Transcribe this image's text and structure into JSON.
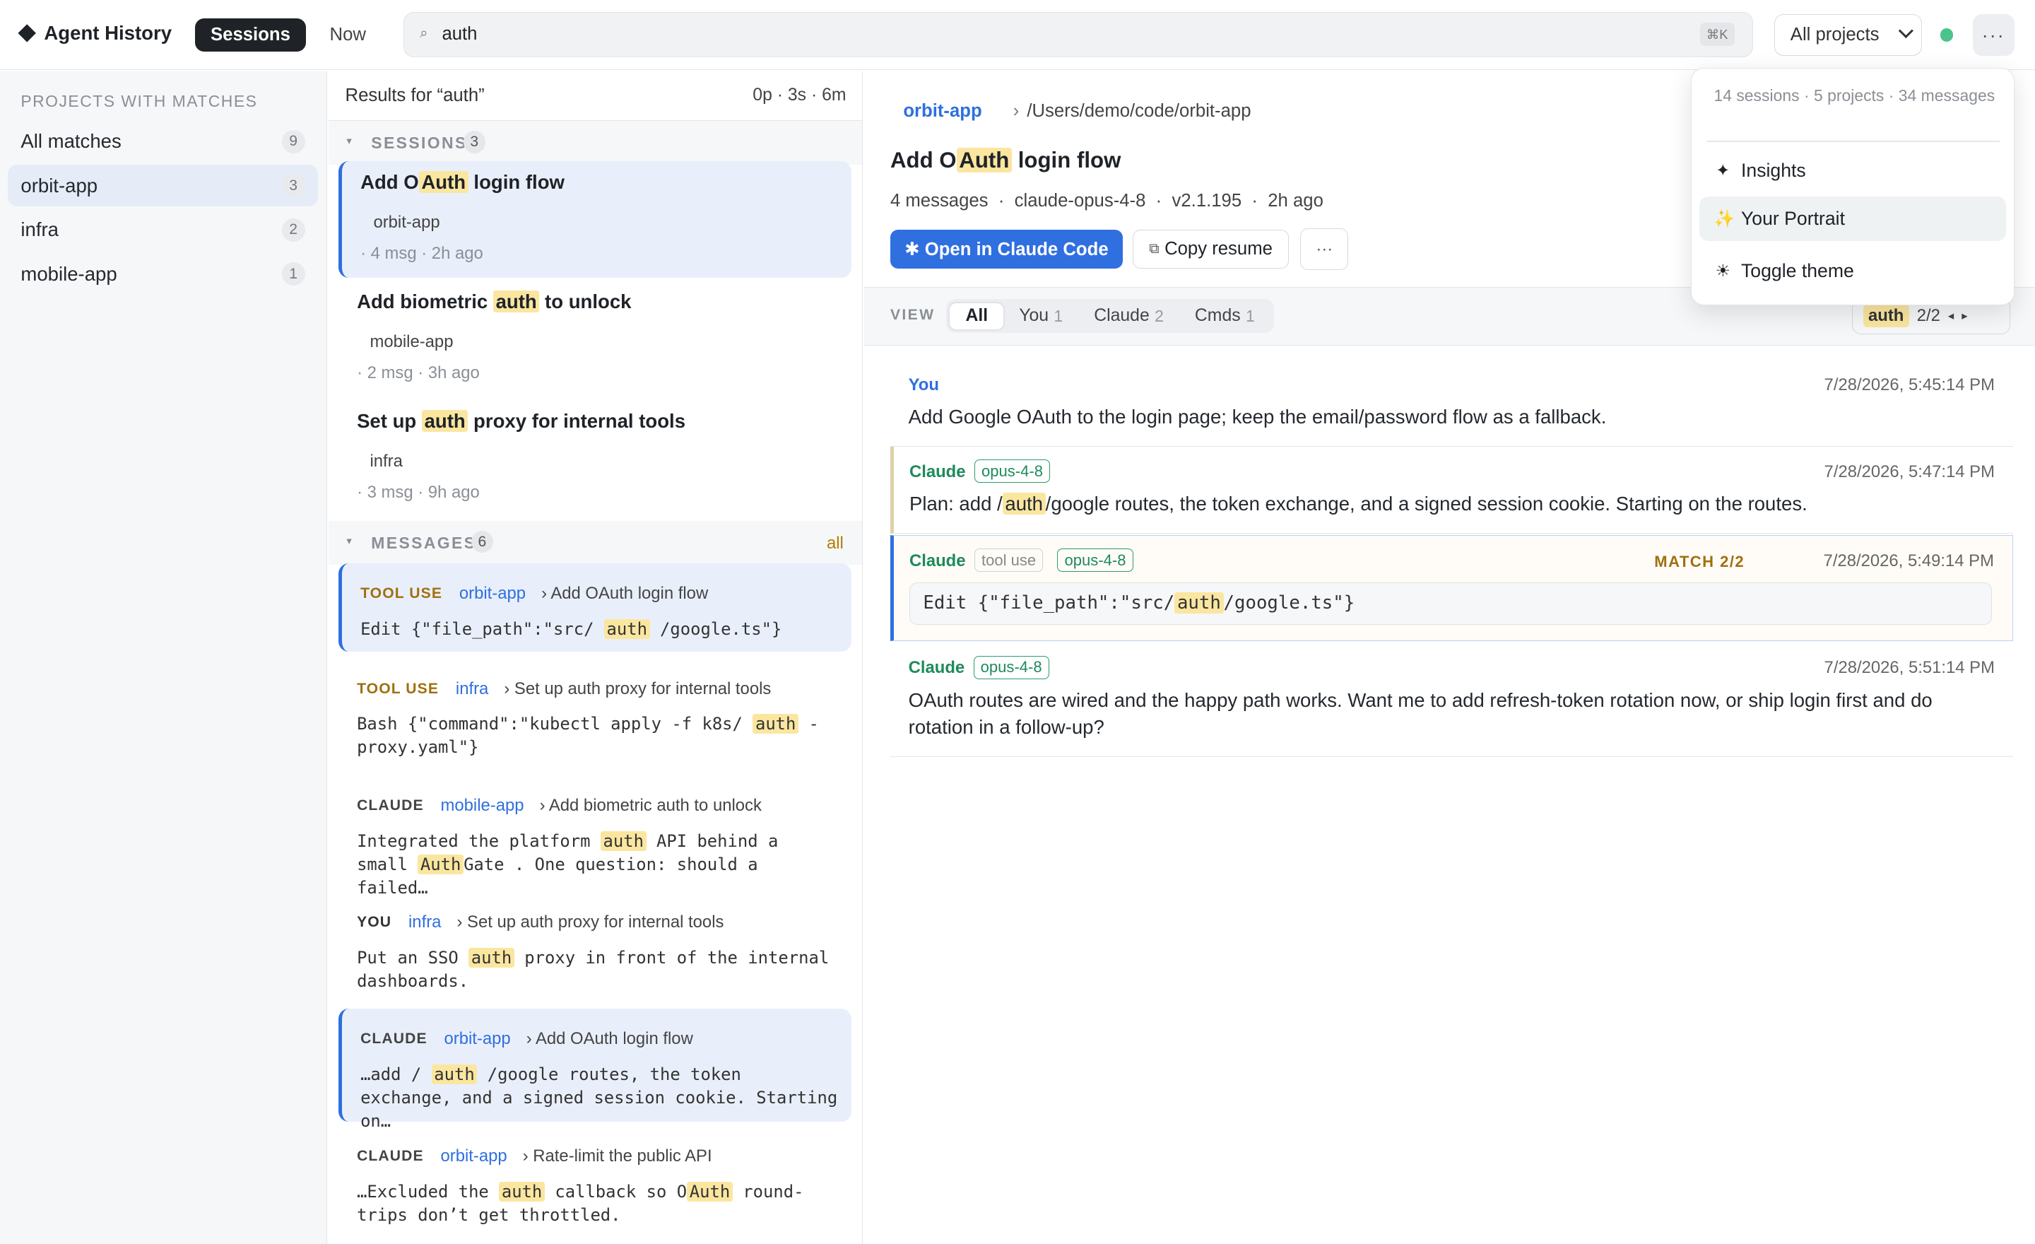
{
  "topbar": {
    "brand": "Agent History",
    "tab_sessions": "Sessions",
    "tab_now": "Now",
    "search_icon": "search-icon",
    "search_value": "auth",
    "search_shortcut": "⌘K",
    "project_filter": "All projects",
    "more_label": "···",
    "status_color": "#4cc38a"
  },
  "sidebar": {
    "heading": "PROJECTS WITH MATCHES",
    "items": [
      {
        "label": "All matches",
        "count": "9"
      },
      {
        "label": "orbit-app",
        "count": "3"
      },
      {
        "label": "infra",
        "count": "2"
      },
      {
        "label": "mobile-app",
        "count": "1"
      }
    ]
  },
  "results": {
    "header_prefix": "Results for “",
    "header_term": "auth",
    "header_suffix": "”",
    "timing": "0p · 3s · 6m",
    "sessions_title": "SESSIONS",
    "sessions_count": "3",
    "sessions": [
      {
        "pre": "Add O",
        "hl": "Auth",
        "post": " login flow",
        "project": "orbit-app",
        "meta": "· 4 msg · 2h ago"
      },
      {
        "pre": "Add biometric ",
        "hl": "auth",
        "post": " to unlock",
        "project": "mobile-app",
        "meta": "· 2 msg · 3h ago"
      },
      {
        "pre": "Set up ",
        "hl": "auth",
        "post": " proxy for internal tools",
        "project": "infra",
        "meta": "· 3 msg · 9h ago"
      }
    ],
    "messages_title": "MESSAGES",
    "messages_count": "6",
    "messages_all": "all",
    "messages": [
      {
        "type": "TOOL USE",
        "project": "orbit-app",
        "session": "› Add OAuth login flow",
        "b1": "Edit {\"file_path\":\"src/ ",
        "h1": "auth",
        "b2": " /google.ts\"}",
        "h2": "",
        "b3": ""
      },
      {
        "type": "TOOL USE",
        "project": "infra",
        "session": "› Set up auth proxy for internal tools",
        "b1": "Bash {\"command\":\"kubectl apply -f k8s/ ",
        "h1": "auth",
        "b2": " -proxy.yaml\"}",
        "h2": "",
        "b3": ""
      },
      {
        "type": "CLAUDE",
        "project": "mobile-app",
        "session": "› Add biometric auth to unlock",
        "b1": "Integrated the platform ",
        "h1": "auth",
        "b2": " API behind a small ",
        "h2": "Auth",
        "b3": "Gate . One question: should a failed…"
      },
      {
        "type": "YOU",
        "project": "infra",
        "session": "› Set up auth proxy for internal tools",
        "b1": "Put an SSO ",
        "h1": "auth",
        "b2": " proxy in front of the internal dashboards.",
        "h2": "",
        "b3": ""
      },
      {
        "type": "CLAUDE",
        "project": "orbit-app",
        "session": "› Add OAuth login flow",
        "b1": "…add / ",
        "h1": "auth",
        "b2": " /google routes, the token exchange, and a signed session cookie. Starting on…",
        "h2": "",
        "b3": ""
      },
      {
        "type": "CLAUDE",
        "project": "orbit-app",
        "session": "› Rate-limit the public API",
        "b1": "…Excluded the ",
        "h1": "auth",
        "b2": " callback so O",
        "h2": "Auth",
        "b3": " round-trips don’t get throttled."
      }
    ]
  },
  "detail": {
    "project": "orbit-app",
    "path": "/Users/demo/code/orbit-app",
    "title_pre": "Add O",
    "title_hl": "Auth",
    "title_post": " login flow",
    "meta": "4 messages  ·  claude-opus-4-8  ·  v2.1.195  ·  2h ago",
    "open_button": "✱ Open in Claude Code",
    "copy_button": "Copy resume",
    "more_label": "···",
    "view_label": "VIEW",
    "filters": [
      {
        "label": "All",
        "count": ""
      },
      {
        "label": "You",
        "count": "1"
      },
      {
        "label": "Claude",
        "count": "2"
      },
      {
        "label": "Cmds",
        "count": "1"
      }
    ],
    "match_term": "auth",
    "match_pos": "2/2",
    "messages": [
      {
        "role": "You",
        "time": "7/28/2026, 5:45:14 PM",
        "text": "Add Google OAuth to the login page; keep the email/password flow as a fallback."
      },
      {
        "role": "Claude",
        "model": "opus-4-8",
        "time": "7/28/2026, 5:47:14 PM",
        "pre": "Plan: add /",
        "hl": "auth",
        "post": "/google routes, the token exchange, and a signed session cookie. Starting on the routes."
      },
      {
        "role": "Claude",
        "tag": "tool use",
        "model": "opus-4-8",
        "match": "MATCH 2/2",
        "time": "7/28/2026, 5:49:14 PM",
        "pre": "Edit {\"file_path\":\"src/",
        "hl": "auth",
        "post": "/google.ts\"}"
      },
      {
        "role": "Claude",
        "model": "opus-4-8",
        "time": "7/28/2026, 5:51:14 PM",
        "text": "OAuth routes are wired and the happy path works. Want me to add refresh-token rotation now, or ship login first and do rotation in a follow-up?"
      }
    ]
  },
  "menu": {
    "stats": "14 sessions · 5 projects · 34 messages",
    "items": [
      {
        "icon": "✦",
        "label": "Insights"
      },
      {
        "icon": "✨",
        "label": "Your Portrait"
      },
      {
        "icon": "☀",
        "label": "Toggle theme"
      }
    ]
  },
  "colors": {
    "accent": "#2f6fe0",
    "highlight": "#fbe6a0",
    "claude_green": "#1e8a5a",
    "tool_amber": "#a0700f"
  }
}
